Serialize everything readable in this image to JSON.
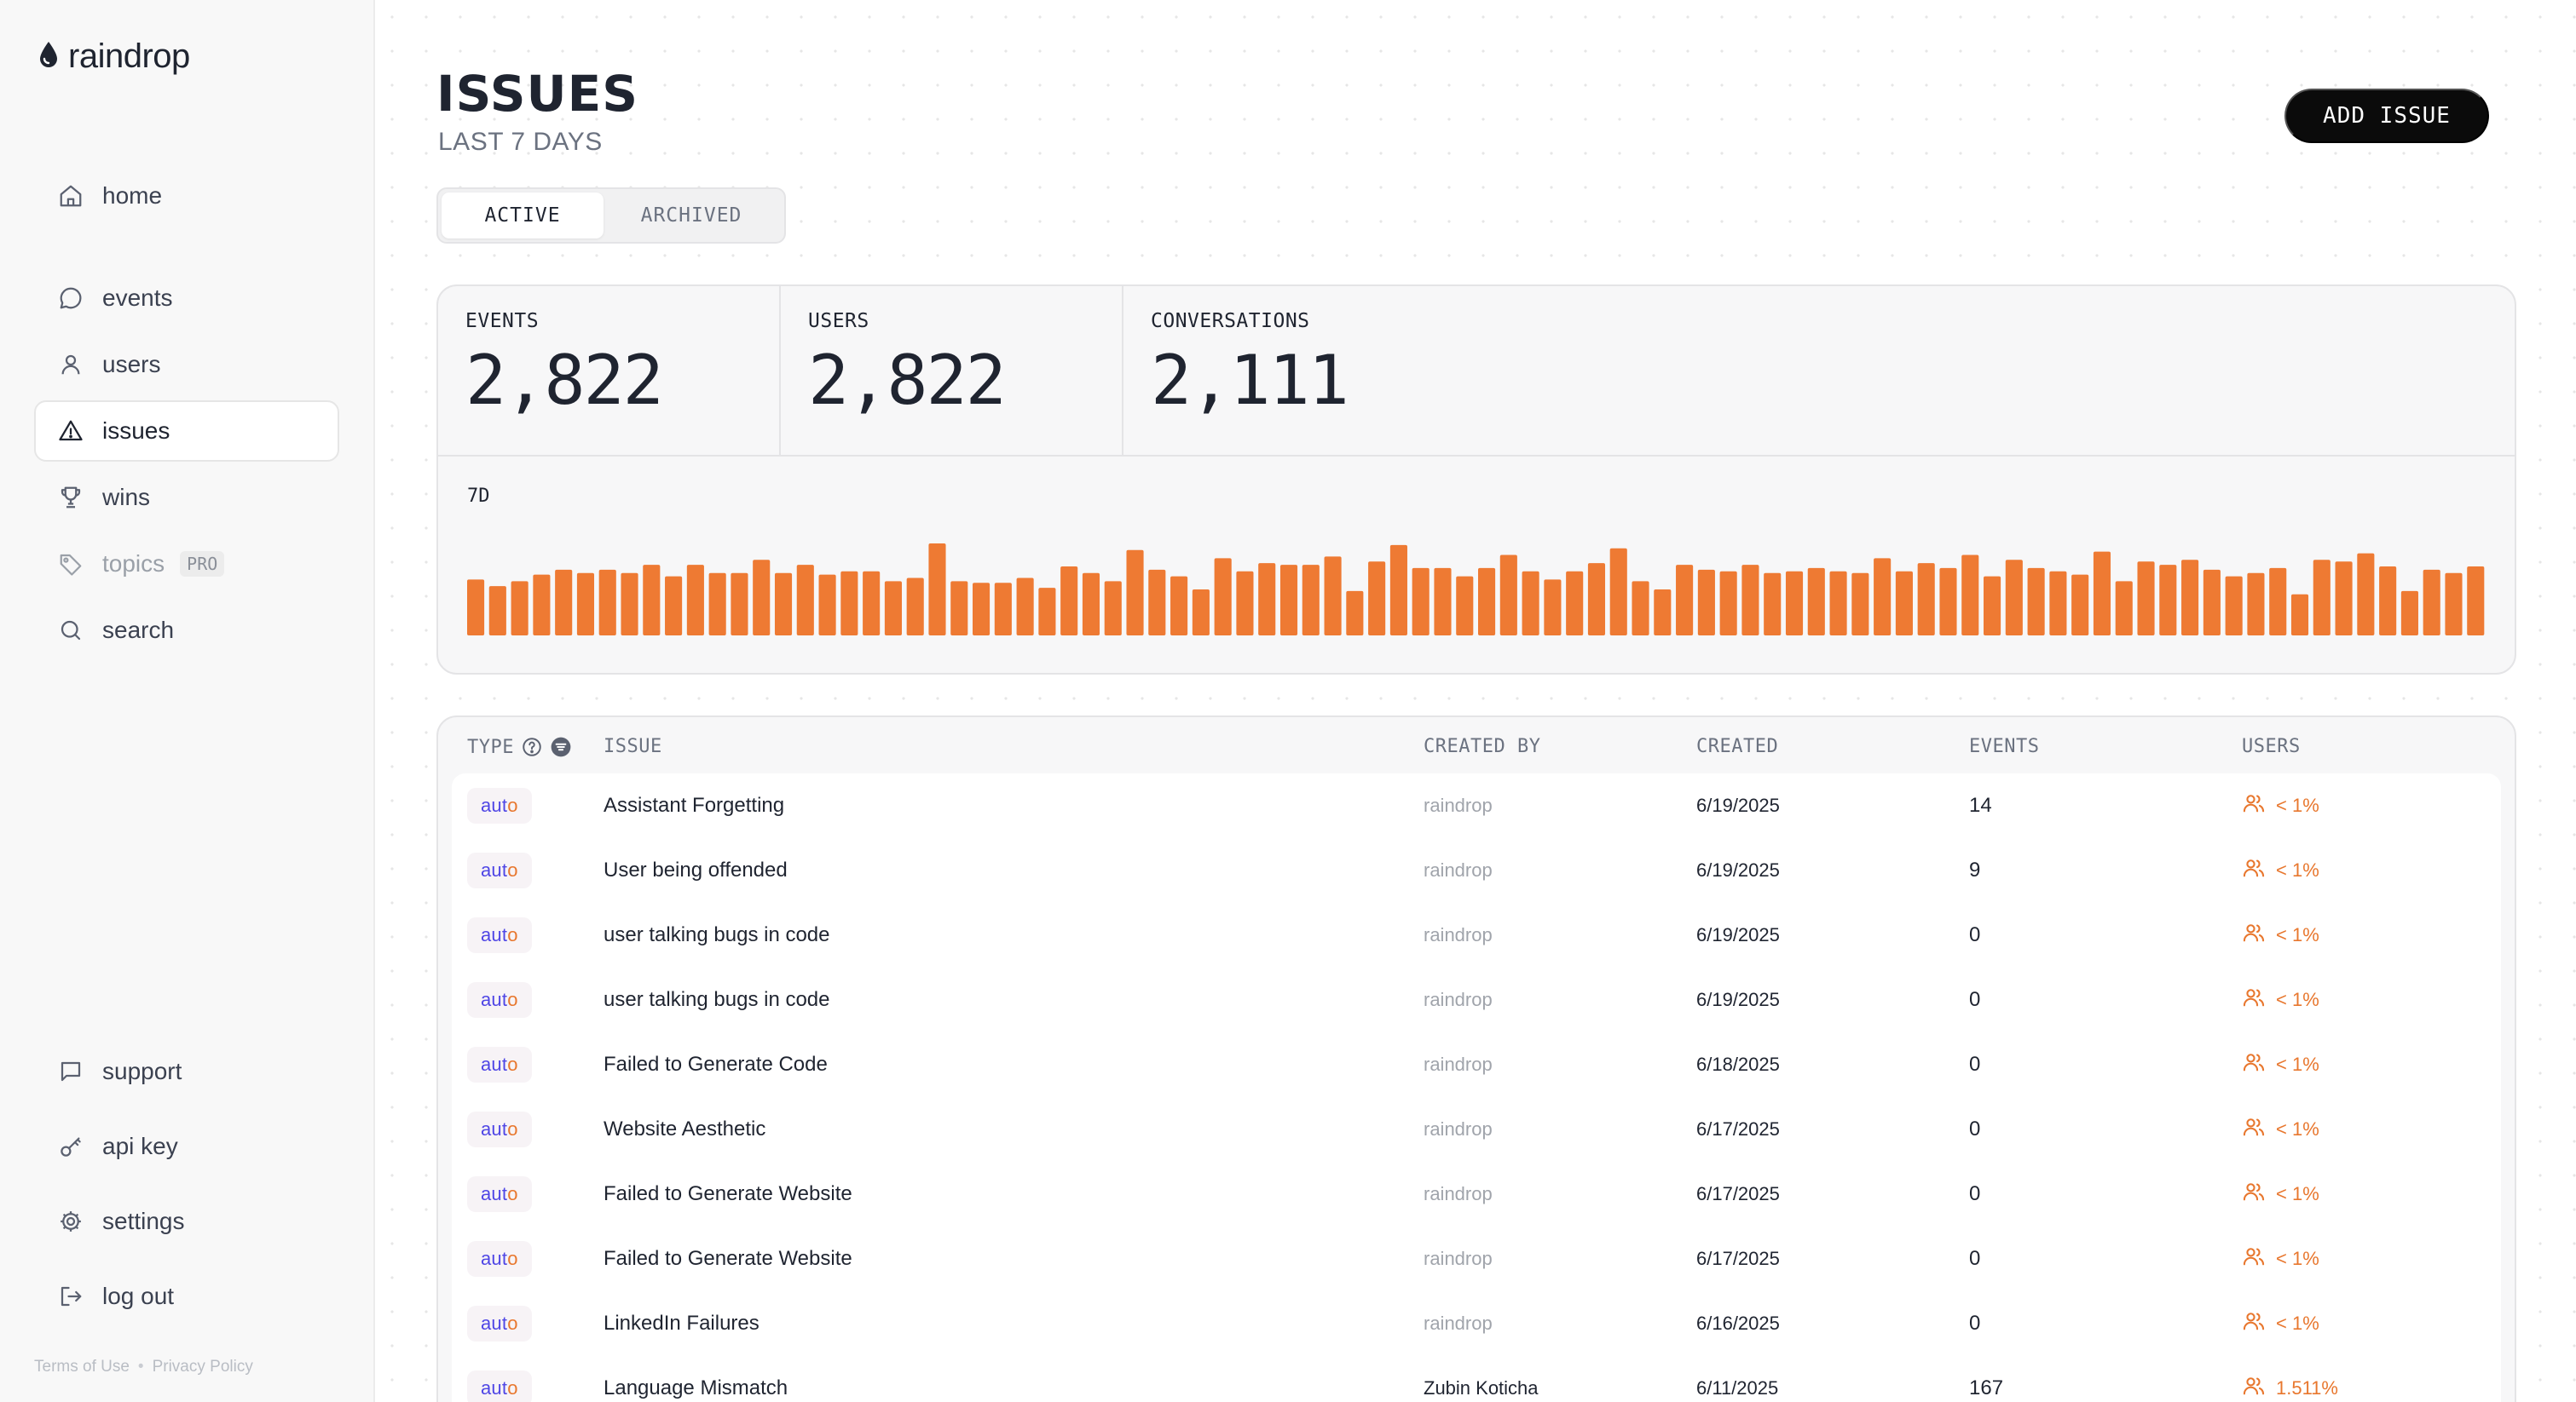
{
  "brand": {
    "name": "raindrop"
  },
  "nav": {
    "items": [
      {
        "label": "home",
        "icon": "home-icon"
      },
      {
        "label": "events",
        "icon": "chat-icon"
      },
      {
        "label": "users",
        "icon": "user-icon"
      },
      {
        "label": "issues",
        "icon": "warning-icon",
        "active": true
      },
      {
        "label": "wins",
        "icon": "trophy-icon"
      },
      {
        "label": "topics",
        "icon": "tag-icon",
        "badge": "PRO",
        "disabled": true
      },
      {
        "label": "search",
        "icon": "search-icon"
      }
    ],
    "bottom": [
      {
        "label": "support",
        "icon": "message-icon"
      },
      {
        "label": "api key",
        "icon": "key-icon"
      },
      {
        "label": "settings",
        "icon": "gear-icon"
      },
      {
        "label": "log out",
        "icon": "logout-icon"
      }
    ],
    "footer": {
      "terms": "Terms of Use",
      "separator": "•",
      "privacy": "Privacy Policy"
    }
  },
  "header": {
    "title": "ISSUES",
    "subtitle": "LAST 7 DAYS",
    "add_button": "ADD ISSUE"
  },
  "tabs": {
    "active": "ACTIVE",
    "archived": "ARCHIVED"
  },
  "stats": {
    "events": {
      "label": "EVENTS",
      "value": "2,822"
    },
    "users": {
      "label": "USERS",
      "value": "2,822"
    },
    "conversations": {
      "label": "CONVERSATIONS",
      "value": "2,111"
    }
  },
  "chart_label": "7D",
  "chart_data": {
    "type": "bar",
    "color": "#ee7a33",
    "values": [
      34,
      30,
      33,
      37,
      40,
      38,
      40,
      38,
      43,
      36,
      43,
      38,
      38,
      46,
      38,
      43,
      37,
      39,
      39,
      33,
      35,
      56,
      33,
      32,
      32,
      35,
      29,
      42,
      38,
      33,
      52,
      40,
      36,
      28,
      47,
      39,
      44,
      43,
      43,
      48,
      27,
      45,
      55,
      41,
      41,
      36,
      41,
      49,
      39,
      34,
      39,
      44,
      53,
      33,
      28,
      43,
      40,
      39,
      43,
      38,
      39,
      41,
      39,
      38,
      47,
      39,
      44,
      41,
      49,
      36,
      46,
      41,
      39,
      37,
      51,
      33,
      45,
      43,
      46,
      40,
      36,
      38,
      41,
      25,
      46,
      45,
      50,
      42,
      27,
      40,
      38,
      42
    ]
  },
  "table": {
    "headers": {
      "type": "TYPE",
      "issue": "ISSUE",
      "created_by": "CREATED BY",
      "created": "CREATED",
      "events": "EVENTS",
      "users": "USERS"
    },
    "rows": [
      {
        "type_main": "aut",
        "type_end": "o",
        "issue": "Assistant Forgetting",
        "created_by": "raindrop",
        "created": "6/19/2025",
        "events": "14",
        "users": "< 1%"
      },
      {
        "type_main": "aut",
        "type_end": "o",
        "issue": "User being offended",
        "created_by": "raindrop",
        "created": "6/19/2025",
        "events": "9",
        "users": "< 1%"
      },
      {
        "type_main": "aut",
        "type_end": "o",
        "issue": "user talking bugs in code",
        "created_by": "raindrop",
        "created": "6/19/2025",
        "events": "0",
        "users": "< 1%"
      },
      {
        "type_main": "aut",
        "type_end": "o",
        "issue": "user talking bugs in code",
        "created_by": "raindrop",
        "created": "6/19/2025",
        "events": "0",
        "users": "< 1%"
      },
      {
        "type_main": "aut",
        "type_end": "o",
        "issue": "Failed to Generate Code",
        "created_by": "raindrop",
        "created": "6/18/2025",
        "events": "0",
        "users": "< 1%"
      },
      {
        "type_main": "aut",
        "type_end": "o",
        "issue": "Website Aesthetic",
        "created_by": "raindrop",
        "created": "6/17/2025",
        "events": "0",
        "users": "< 1%"
      },
      {
        "type_main": "aut",
        "type_end": "o",
        "issue": "Failed to Generate Website",
        "created_by": "raindrop",
        "created": "6/17/2025",
        "events": "0",
        "users": "< 1%"
      },
      {
        "type_main": "aut",
        "type_end": "o",
        "issue": "Failed to Generate Website",
        "created_by": "raindrop",
        "created": "6/17/2025",
        "events": "0",
        "users": "< 1%"
      },
      {
        "type_main": "aut",
        "type_end": "o",
        "issue": "LinkedIn Failures",
        "created_by": "raindrop",
        "created": "6/16/2025",
        "events": "0",
        "users": "< 1%"
      },
      {
        "type_main": "aut",
        "type_end": "o",
        "issue": "Language Mismatch",
        "created_by": "Zubin Koticha",
        "created": "6/11/2025",
        "events": "167",
        "users": "1.511%"
      }
    ]
  }
}
